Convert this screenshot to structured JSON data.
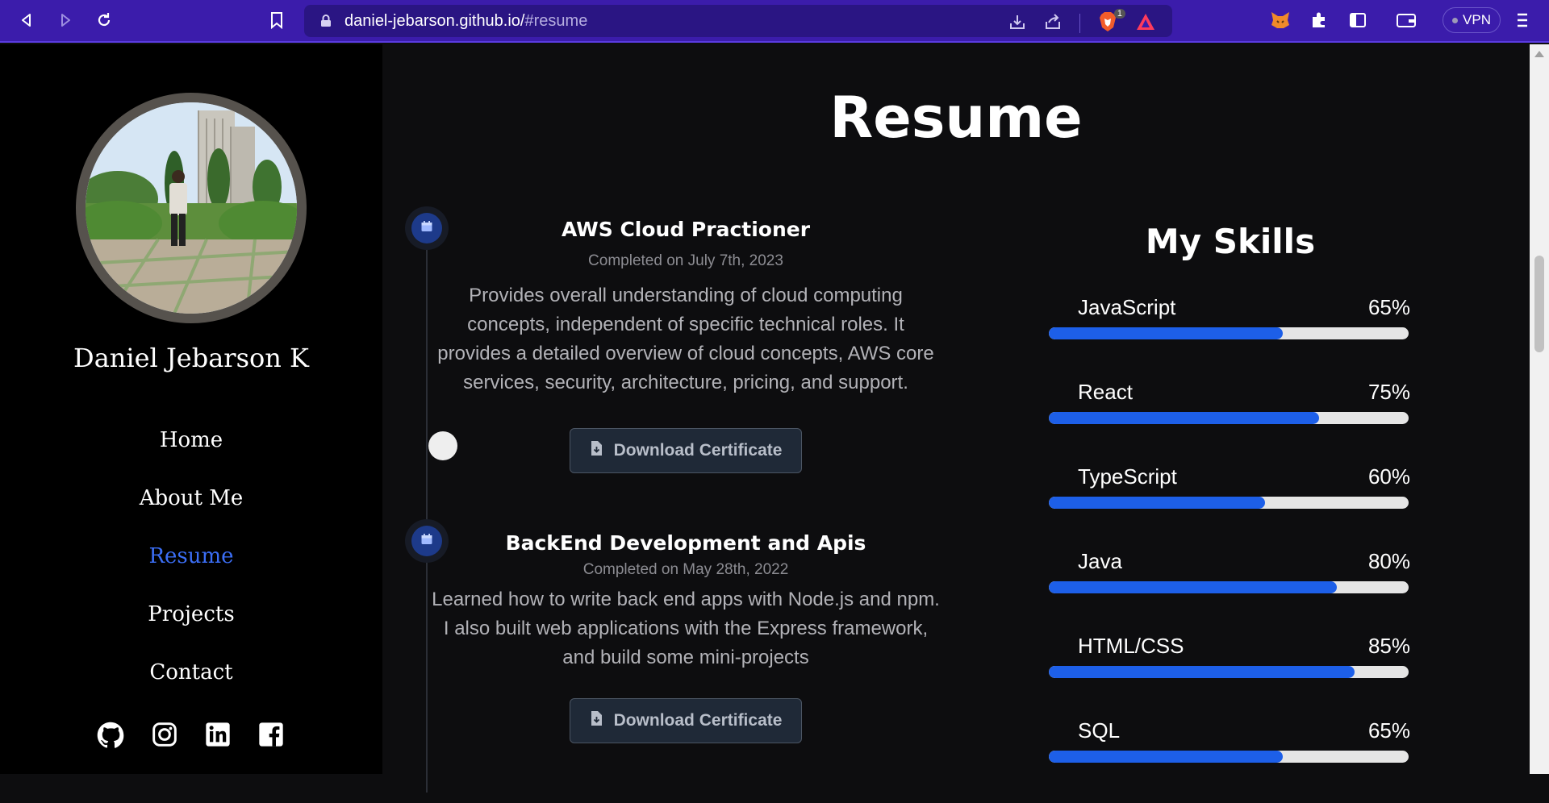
{
  "browser": {
    "url_host": "daniel-jebarson.github.io/",
    "url_fragment": "#resume",
    "vpn_label": "VPN",
    "brave_badge": "1"
  },
  "sidebar": {
    "name": "Daniel Jebarson K",
    "menu": [
      {
        "label": "Home",
        "active": false
      },
      {
        "label": "About Me",
        "active": false
      },
      {
        "label": "Resume",
        "active": true
      },
      {
        "label": "Projects",
        "active": false
      },
      {
        "label": "Contact",
        "active": false
      }
    ],
    "social_icons": [
      "github-icon",
      "instagram-icon",
      "linkedin-icon",
      "facebook-icon"
    ]
  },
  "main": {
    "title": "Resume",
    "timeline": [
      {
        "title": "AWS Cloud Practioner",
        "date": "Completed on July 7th, 2023",
        "description": "Provides overall understanding of cloud computing concepts, independent of specific technical roles. It provides a detailed overview of cloud concepts, AWS core services, security, architecture, pricing, and support.",
        "button": "Download Certificate"
      },
      {
        "title": "BackEnd Development and Apis",
        "date": "Completed on May 28th, 2022",
        "description": "Learned how to write back end apps with Node.js and npm. I also built web applications with the Express framework, and build some mini-projects",
        "button": "Download Certificate"
      }
    ],
    "skills": {
      "title": "My Skills",
      "items": [
        {
          "name": "JavaScript",
          "label": "65%",
          "percent": 65
        },
        {
          "name": "React",
          "label": "75%",
          "percent": 75
        },
        {
          "name": "TypeScript",
          "label": "60%",
          "percent": 60
        },
        {
          "name": "Java",
          "label": "80%",
          "percent": 80
        },
        {
          "name": "HTML/CSS",
          "label": "85%",
          "percent": 85
        },
        {
          "name": "SQL",
          "label": "65%",
          "percent": 65
        }
      ]
    }
  },
  "colors": {
    "accent": "#3b6ef5",
    "progress_fill": "#1d5fe8",
    "chrome": "#3b1cab"
  }
}
